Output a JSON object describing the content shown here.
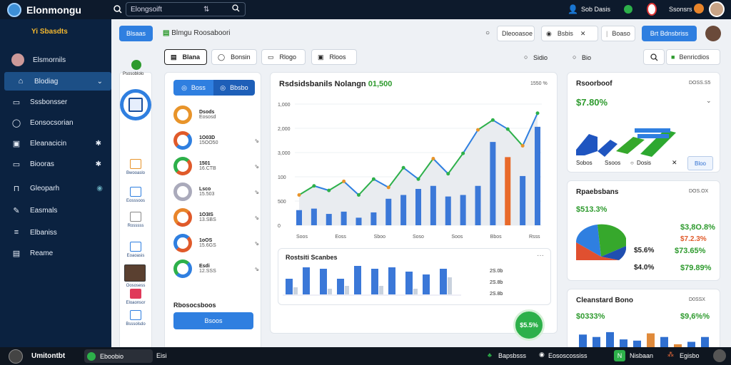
{
  "app": {
    "title": "Elonmongu"
  },
  "search": {
    "value": "Elongsoift"
  },
  "topbar_right": {
    "item1": "Sob Dasis",
    "item2": "Ssonsrs"
  },
  "sidebar": {
    "brand": "Yi Sbasdts",
    "items": [
      {
        "label": "Elsmornils",
        "icon": "user-avatar-icon"
      },
      {
        "label": "Blodiag",
        "icon": "home-icon"
      },
      {
        "label": "Sssbonsser",
        "icon": "folder-icon"
      },
      {
        "label": "Eonsocsorian",
        "icon": "chat-icon"
      },
      {
        "label": "Eleanacicin",
        "icon": "image-icon"
      },
      {
        "label": "Biooras",
        "icon": "monitor-icon"
      },
      {
        "label": "Gleoparh",
        "icon": "lock-icon"
      },
      {
        "label": "Easmals",
        "icon": "pen-icon"
      },
      {
        "label": "Elbaniss",
        "icon": "server-icon"
      },
      {
        "label": "Reame",
        "icon": "document-icon"
      }
    ]
  },
  "header": {
    "btn": "Blsaas",
    "title": "Blmgu Roosaboori",
    "pill1": "Dleooasoe",
    "pill2": "Bsbis",
    "pill3": "Boaso",
    "btn2": "Brt Bdnsbriss"
  },
  "tabs": [
    "Blana",
    "Bonsin",
    "Rlogo",
    "Rloos"
  ],
  "tab_right": {
    "a": "Sidio",
    "b": "Bio"
  },
  "right_tab": "Benricdios",
  "mini_panel": {
    "items": [
      "Psosoblolo",
      "Bwooaslo",
      "Eosssoos",
      "Rosssss",
      "Eoaoasis",
      "Oososess",
      "Eloaonsor",
      "Bsssolsdo"
    ]
  },
  "donut_panel": {
    "toggle_a": "Boss",
    "toggle_b": "Bbsbo",
    "rows": [
      {
        "a": "Dsods",
        "b": "Eososd"
      },
      {
        "a": "1O03D",
        "b": "15OO50"
      },
      {
        "a": "1501",
        "b": "16.CTB"
      },
      {
        "a": "Lsco",
        "b": "15.503"
      },
      {
        "a": "1O3IS",
        "b": "13.SBS"
      },
      {
        "a": "1oOS",
        "b": "15.6GS"
      },
      {
        "a": "Esdi",
        "b": "12.SSS"
      }
    ],
    "footer": "Rbosocsboos",
    "button": "Bsoos"
  },
  "main_chart": {
    "title": "Rsdsidsbanils Nolangn",
    "title_value": "01,500",
    "corner": "1550 %",
    "xlabels": [
      "Soos",
      "Eoss",
      "Sboo",
      "Soso",
      "Soos",
      "Bbos",
      "Rsss"
    ]
  },
  "sub_chart": {
    "title": "Rostsiti Scanbes",
    "labels": [
      "2S.0b",
      "2S.8b",
      "2S.8b"
    ]
  },
  "card_r1": {
    "title": "Rsoorboof",
    "corner": "DOSS.S5",
    "value": "$7.80%",
    "stats": {
      "a": "Sobos",
      "b": "Ssoos",
      "c": "Dosis"
    },
    "btn": "Bloo"
  },
  "card_r2": {
    "title": "Rpaebsbans",
    "corner": "DOS.OX",
    "left1": "$513.3%",
    "left2": "$5.6%",
    "left3": "$4.0%",
    "right1": "$3,8O.8%",
    "right2": "$7.2.3%",
    "right3": "$73.65%",
    "right4": "$79.89%"
  },
  "card_r3": {
    "title": "Cleanstard Bono",
    "corner": "D0SSX",
    "left": "$0333%",
    "right": "$9,6%%"
  },
  "fab": "$5.5%",
  "bottombar": {
    "title": "Umitontbt",
    "badge": "Eboobio",
    "item1": "Eisi",
    "r1": "Bapsbsss",
    "r2": "Eososcossiss",
    "r3": "Nisbaan",
    "r4": "Egisbo"
  },
  "chart_data": [
    {
      "type": "line",
      "title": "Rsdsidsbanils Nolangn",
      "x": [
        "Soos",
        "Eoss",
        "Sboo",
        "Soso",
        "Soos",
        "Bbos",
        "Rsss"
      ],
      "yticks": [
        "1,000",
        "2,000",
        "3,000",
        "100",
        "500",
        "0"
      ],
      "series": [
        {
          "values": [
            40,
            52,
            46,
            58,
            40,
            61,
            50,
            76,
            61,
            88,
            68,
            95,
            126,
            139,
            127,
            105,
            148
          ]
        }
      ],
      "bars": [
        20,
        22,
        15,
        18,
        10,
        17,
        35,
        40,
        48,
        52,
        38,
        40,
        52,
        110,
        90,
        65,
        130
      ]
    },
    {
      "type": "bar",
      "title": "Rostsiti Scanbes",
      "values": [
        0.55,
        0.95,
        0.9,
        0.55,
        1.0,
        0.9,
        0.95,
        0.8,
        0.7,
        0.9
      ],
      "secondary": [
        0.25,
        0,
        0.2,
        0.3,
        0,
        0.3,
        0,
        0.2,
        0,
        0.6
      ]
    },
    {
      "type": "bar",
      "title": "Cleanstard Bono",
      "values": [
        0.55,
        0.45,
        0.65,
        0.35,
        0.3,
        0.6,
        0.45,
        0.15,
        0.25,
        0.45
      ],
      "colors": [
        "#2f6fd0",
        "#2f6fd0",
        "#2f6fd0",
        "#2f6fd0",
        "#2f6fd0",
        "#e08a3a",
        "#2f6fd0",
        "#e08a3a",
        "#2f6fd0",
        "#2f6fd0"
      ]
    }
  ]
}
